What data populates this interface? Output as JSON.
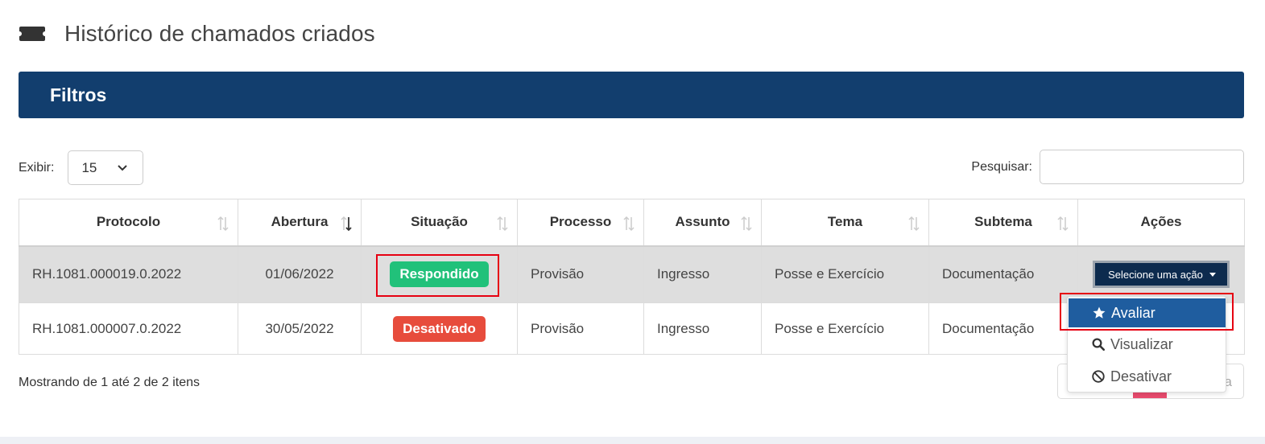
{
  "header": {
    "title": "Histórico de chamados criados",
    "icon": "ticket-icon"
  },
  "filters": {
    "label": "Filtros",
    "color": "#123e6e"
  },
  "length": {
    "label": "Exibir:",
    "value": "15"
  },
  "search": {
    "label": "Pesquisar:",
    "value": "",
    "placeholder": ""
  },
  "table": {
    "headers": [
      "Protocolo",
      "Abertura",
      "Situação",
      "Processo",
      "Assunto",
      "Tema",
      "Subtema",
      "Ações"
    ],
    "rows": [
      {
        "protocolo": "RH.1081.000019.0.2022",
        "abertura": "01/06/2022",
        "situacao": "Respondido",
        "situacao_color": "#21c17a",
        "processo": "Provisão",
        "assunto": "Ingresso",
        "tema": "Posse e Exercício",
        "subtema": "Documentação",
        "acao": "Selecione uma ação"
      },
      {
        "protocolo": "RH.1081.000007.0.2022",
        "abertura": "30/05/2022",
        "situacao": "Desativado",
        "situacao_color": "#e74c3c",
        "processo": "Provisão",
        "assunto": "Ingresso",
        "tema": "Posse e Exercício",
        "subtema": "Documentação"
      }
    ]
  },
  "dropdown": {
    "items": [
      {
        "label": "Avaliar",
        "icon": "star-icon"
      },
      {
        "label": "Visualizar",
        "icon": "search-icon"
      },
      {
        "label": "Desativar",
        "icon": "ban-icon"
      }
    ]
  },
  "info": "Mostrando de 1 até 2 de 2 itens",
  "pagination": {
    "next_label": "a"
  },
  "colors": {
    "highlight": "#e60012",
    "menu_active": "#1f5d9f",
    "action_button": "#0d2b4e"
  }
}
